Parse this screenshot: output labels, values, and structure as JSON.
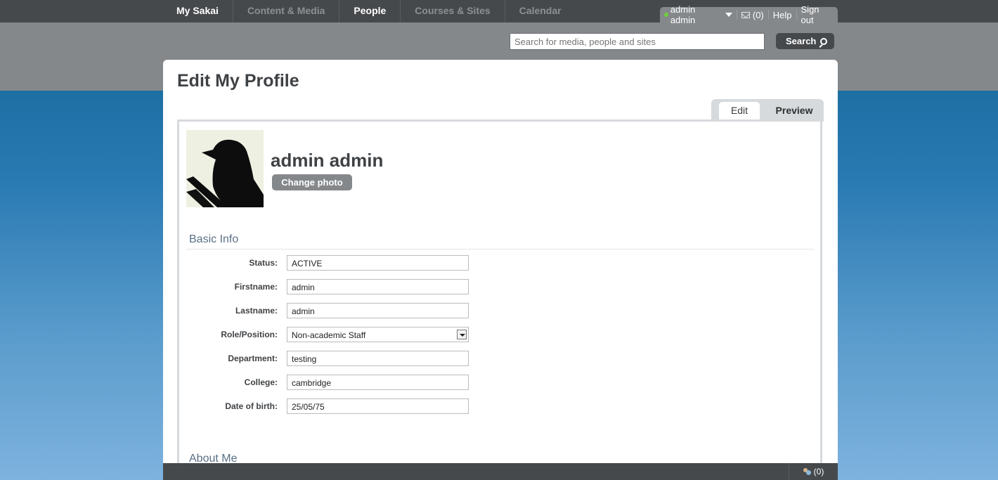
{
  "nav": {
    "items": [
      {
        "label": "My Sakai",
        "active": true
      },
      {
        "label": "Content & Media",
        "active": false
      },
      {
        "label": "People",
        "active": true
      },
      {
        "label": "Courses & Sites",
        "active": false
      },
      {
        "label": "Calendar",
        "active": false
      }
    ]
  },
  "usermenu": {
    "username": "admin admin",
    "messages": "(0)",
    "help": "Help",
    "signout": "Sign out"
  },
  "search": {
    "placeholder": "Search for media, people and sites",
    "button_label": "Search"
  },
  "page": {
    "title": "Edit My Profile",
    "tabs": {
      "edit": "Edit",
      "preview": "Preview"
    }
  },
  "profile": {
    "name": "admin admin",
    "change_photo_label": "Change photo"
  },
  "basic_info": {
    "title": "Basic Info",
    "fields": [
      {
        "label": "Status:",
        "value": "ACTIVE",
        "type": "text"
      },
      {
        "label": "Firstname:",
        "value": "admin",
        "type": "text"
      },
      {
        "label": "Lastname:",
        "value": "admin",
        "type": "text"
      },
      {
        "label": "Role/Position:",
        "value": "Non-academic Staff",
        "type": "select"
      },
      {
        "label": "Department:",
        "value": "testing",
        "type": "text"
      },
      {
        "label": "College:",
        "value": "cambridge",
        "type": "text"
      },
      {
        "label": "Date of birth:",
        "value": "25/05/75",
        "type": "text"
      }
    ]
  },
  "about_me": {
    "title": "About Me"
  },
  "footer": {
    "chat_count": "(0)"
  }
}
